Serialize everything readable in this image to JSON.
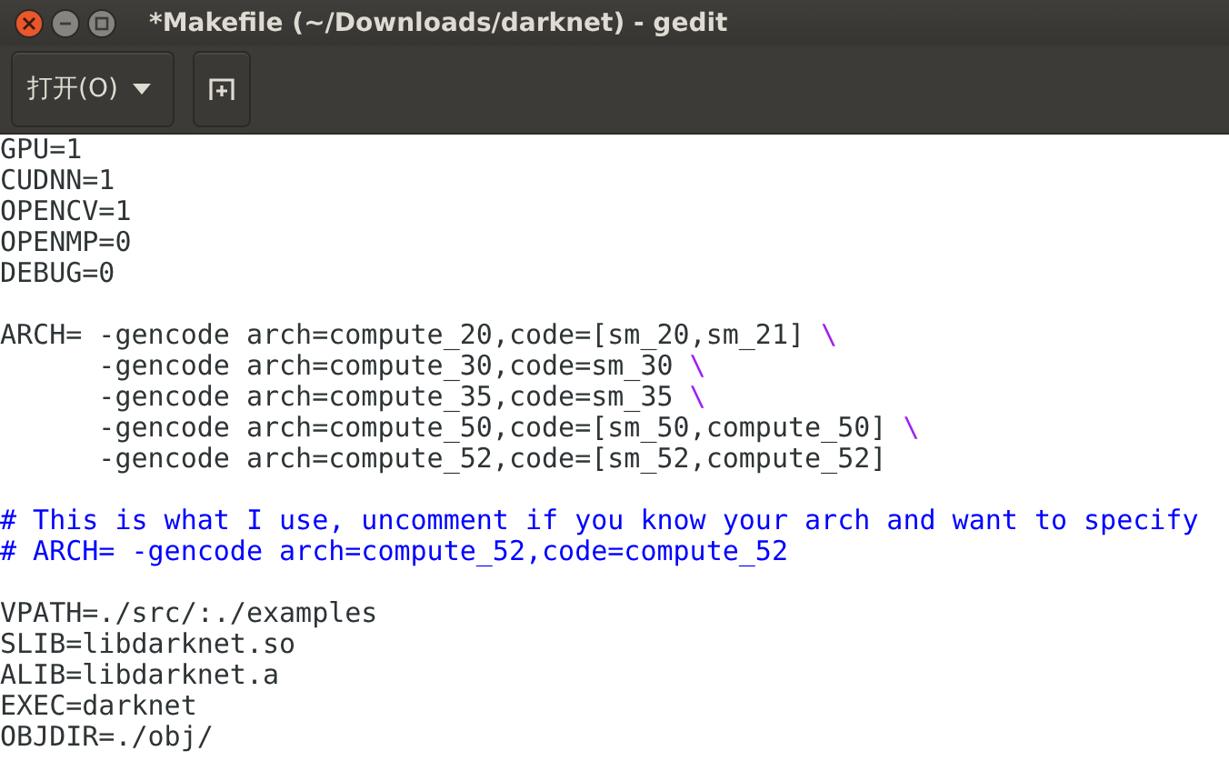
{
  "window": {
    "title": "*Makefile (~/Downloads/darknet) - gedit"
  },
  "toolbar": {
    "open_button": "打开(O)"
  },
  "editor": {
    "blocks": [
      [
        {
          "kind": "code",
          "text": "GPU=1"
        },
        {
          "kind": "code",
          "text": "CUDNN=1"
        },
        {
          "kind": "code",
          "text": "OPENCV=1"
        },
        {
          "kind": "code",
          "text": "OPENMP=0"
        },
        {
          "kind": "code",
          "text": "DEBUG=0"
        }
      ],
      [
        {
          "kind": "code",
          "text": "ARCH= -gencode arch=compute_20,code=[sm_20,sm_21] ",
          "continuation": "\\"
        },
        {
          "kind": "code",
          "text": "      -gencode arch=compute_30,code=sm_30 ",
          "continuation": "\\"
        },
        {
          "kind": "code",
          "text": "      -gencode arch=compute_35,code=sm_35 ",
          "continuation": "\\"
        },
        {
          "kind": "code",
          "text": "      -gencode arch=compute_50,code=[sm_50,compute_50] ",
          "continuation": "\\"
        },
        {
          "kind": "code",
          "text": "      -gencode arch=compute_52,code=[sm_52,compute_52]"
        }
      ],
      [
        {
          "kind": "comment",
          "text": "# This is what I use, uncomment if you know your arch and want to specify"
        },
        {
          "kind": "comment",
          "text": "# ARCH= -gencode arch=compute_52,code=compute_52"
        }
      ],
      [
        {
          "kind": "code",
          "text": "VPATH=./src/:./examples"
        },
        {
          "kind": "code",
          "text": "SLIB=libdarknet.so"
        },
        {
          "kind": "code",
          "text": "ALIB=libdarknet.a"
        },
        {
          "kind": "code",
          "text": "EXEC=darknet"
        },
        {
          "kind": "code",
          "text": "OBJDIR=./obj/"
        }
      ]
    ]
  }
}
